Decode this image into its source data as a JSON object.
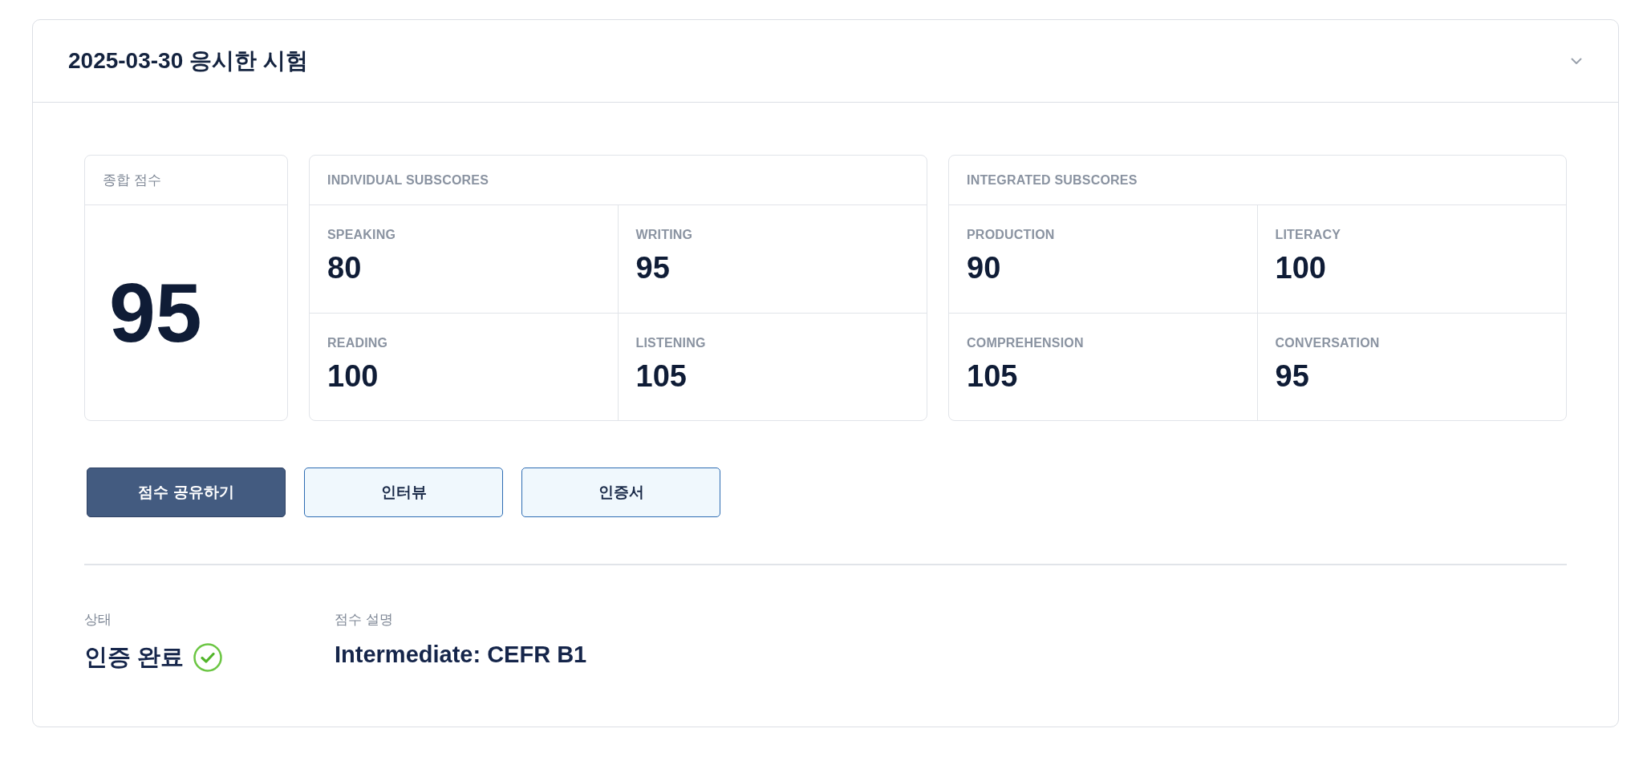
{
  "exam": {
    "title": "2025-03-30 응시한 시험",
    "expanded": true
  },
  "total_score": {
    "label": "종합 점수",
    "value": "95"
  },
  "subscore_groups": [
    {
      "title": "INDIVIDUAL SUBSCORES",
      "items": [
        {
          "label": "SPEAKING",
          "value": "80"
        },
        {
          "label": "WRITING",
          "value": "95"
        },
        {
          "label": "READING",
          "value": "100"
        },
        {
          "label": "LISTENING",
          "value": "105"
        }
      ]
    },
    {
      "title": "INTEGRATED SUBSCORES",
      "items": [
        {
          "label": "PRODUCTION",
          "value": "90"
        },
        {
          "label": "LITERACY",
          "value": "100"
        },
        {
          "label": "COMPREHENSION",
          "value": "105"
        },
        {
          "label": "CONVERSATION",
          "value": "95"
        }
      ]
    }
  ],
  "buttons": [
    {
      "label": "점수 공유하기",
      "kind": "primary"
    },
    {
      "label": "인터뷰",
      "kind": "secondary"
    },
    {
      "label": "인증서",
      "kind": "secondary"
    }
  ],
  "status": {
    "label": "상태",
    "value": "인증 완료",
    "verified": true
  },
  "score_description": {
    "label": "점수 설명",
    "value": "Intermediate: CEFR B1"
  }
}
